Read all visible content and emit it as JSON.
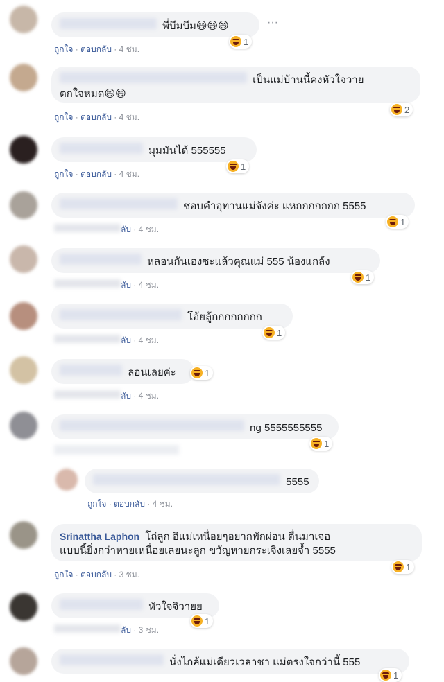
{
  "comments": [
    {
      "name": "",
      "text": "พี่บึมบึม😄😄😄",
      "like": "ถูกใจ",
      "reply": "ตอบกลับ",
      "time": "4 ชม.",
      "reaction_count": "1",
      "more": "···"
    },
    {
      "name": "",
      "text": "เป็นแม่บ้านนี้คงหัวใจวาย\nตกใจหมด😄😄",
      "like": "ถูกใจ",
      "reply": "ตอบกลับ",
      "time": "4 ชม.",
      "reaction_count": "2"
    },
    {
      "name": "",
      "text": "มุมมันได้ 555555",
      "like": "ถูกใจ",
      "reply": "ตอบกลับ",
      "time": "4 ชม.",
      "reaction_count": "1"
    },
    {
      "name": "",
      "text": "ชอบคำอุทานแม่จังค่ะ แหกกกกกกก 5555",
      "like": "",
      "reply": "ลับ",
      "time": "4 ชม.",
      "reaction_count": "1"
    },
    {
      "name": "",
      "text": "หลอนกันเองซะแล้วคุณแม่ 555 น้องแกล้ง",
      "like": "",
      "reply": "ลับ",
      "time": "4 ชม.",
      "reaction_count": "1"
    },
    {
      "name": "",
      "text": "โอ้ยลู้กกกกกกกก",
      "like": "",
      "reply": "ลับ",
      "time": "4 ชม.",
      "reaction_count": "1"
    },
    {
      "name": "",
      "text": "ลอนเลยค่ะ",
      "like": "",
      "reply": "ลับ",
      "time": "4 ชม.",
      "reaction_count": "1"
    },
    {
      "name": "",
      "text": "ng 5555555555",
      "like": "",
      "reply": "",
      "time": "",
      "reaction_count": "1"
    },
    {
      "name": "",
      "text": "5555",
      "like": "ถูกใจ",
      "reply": "ตอบกลับ",
      "time": "4 ชม.",
      "reaction_count": ""
    },
    {
      "name": "Srinattha Laphon",
      "text": "โถ่ลูก อิแม่เหนื่อยๆอยากพักผ่อน ตื่นมาเจอ\nแบบนี้ยิ่งกว่าหายเหนื่อยเลยนะลูก ขวัญหายกระเจิงเลยจ้ำ 5555",
      "like": "ถูกใจ",
      "reply": "ตอบกลับ",
      "time": "3 ชม.",
      "reaction_count": "1"
    },
    {
      "name": "",
      "text": "หัวใจจิวายย",
      "like": "",
      "reply": "ลับ",
      "time": "3 ชม.",
      "reaction_count": "1"
    },
    {
      "name": "",
      "text": "นั่งไกล้แม่เดียวเวลาชา แม่ตรงใจกว่านี้ 555",
      "like": "",
      "reply": "",
      "time": "",
      "reaction_count": "1"
    }
  ],
  "separator": " · "
}
